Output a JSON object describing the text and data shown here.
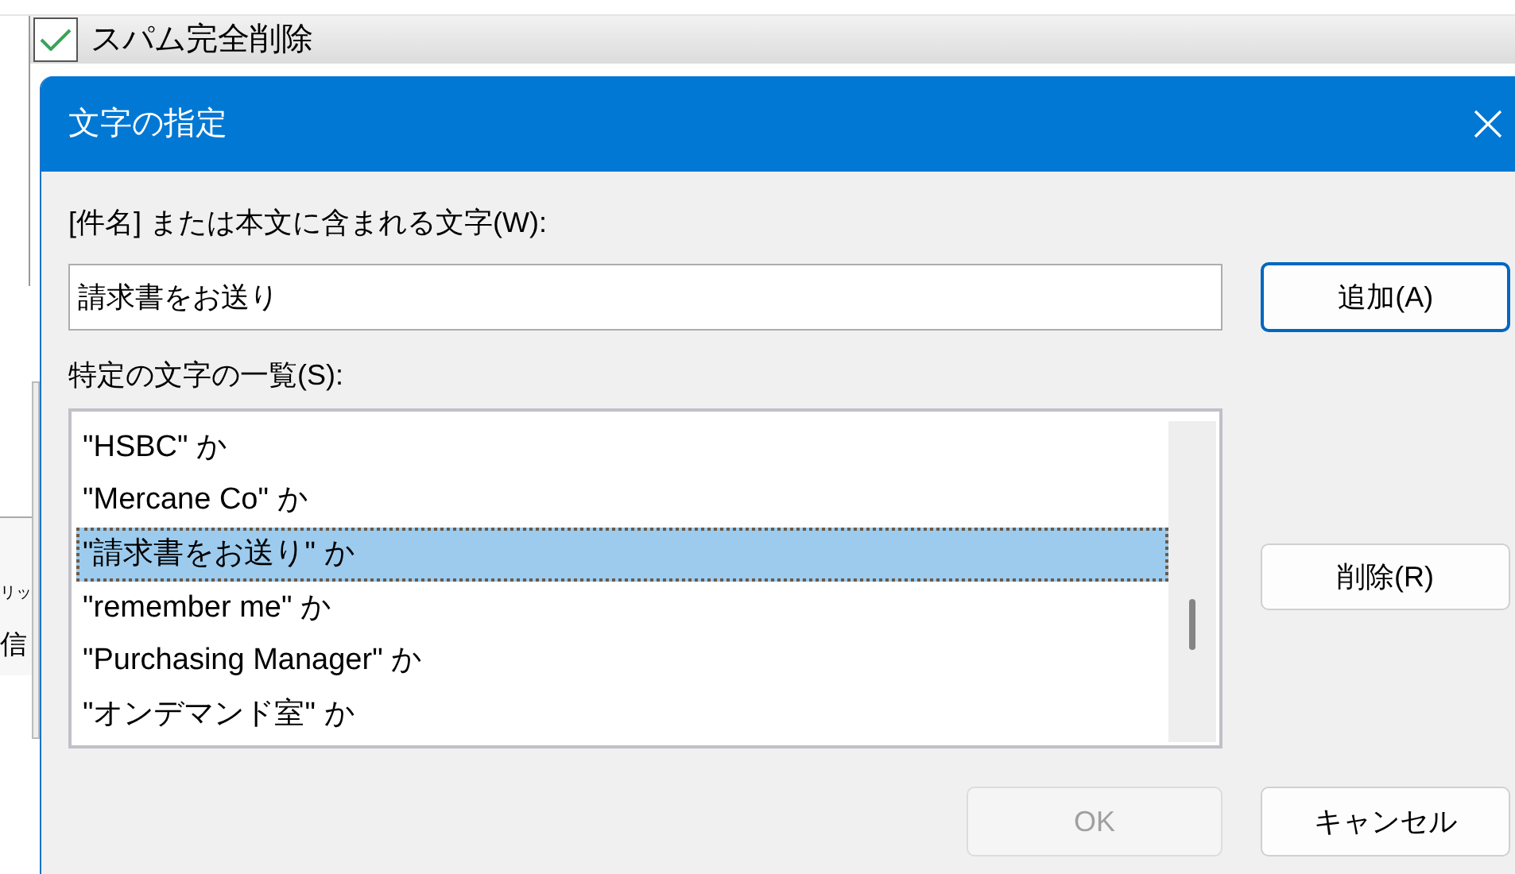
{
  "background_window": {
    "rule": {
      "label": "スパム完全削除",
      "checked": true
    },
    "side_texts": [
      "リッ",
      "信"
    ]
  },
  "dialog": {
    "title": "文字の指定",
    "field_label": "[件名] または本文に含まれる文字(W):",
    "field_value": "請求書をお送り",
    "add_button": "追加(A)",
    "list_label": "特定の文字の一覧(S):",
    "items": [
      {
        "text": "\"HSBC\" か",
        "selected": false
      },
      {
        "text": "\"Mercane Co\" か",
        "selected": false
      },
      {
        "text": "\"請求書をお送り\" か",
        "selected": true
      },
      {
        "text": "\"remember me\" か",
        "selected": false
      },
      {
        "text": "\"Purchasing Manager\" か",
        "selected": false
      },
      {
        "text": "\"オンデマンド室\" か",
        "selected": false
      }
    ],
    "remove_button": "削除(R)",
    "ok_button": {
      "label": "OK",
      "disabled": true
    },
    "cancel_button": "キャンセル"
  }
}
